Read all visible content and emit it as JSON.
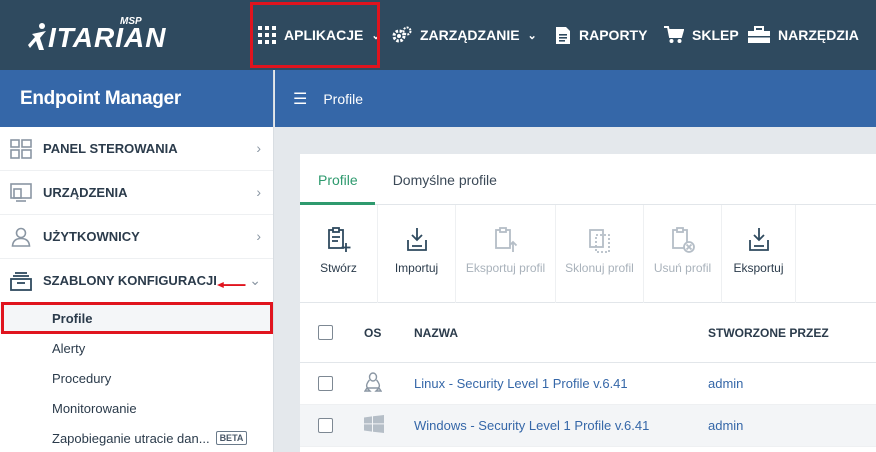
{
  "brand": {
    "name": "ITARIAN",
    "badge": "MSP"
  },
  "topnav": {
    "apps": "APLIKACJE",
    "management": "ZARZĄDZANIE",
    "reports": "RAPORTY",
    "shop": "SKLEP",
    "tools": "NARZĘDZIA"
  },
  "sidebar": {
    "title": "Endpoint Manager",
    "items": [
      {
        "label": "PANEL STEROWANIA",
        "icon": "dashboard-icon"
      },
      {
        "label": "URZĄDZENIA",
        "icon": "devices-icon"
      },
      {
        "label": "UŻYTKOWNICY",
        "icon": "user-icon"
      },
      {
        "label": "SZABLONY KONFIGURACJI",
        "icon": "templates-icon"
      }
    ],
    "subitems": [
      "Profile",
      "Alerty",
      "Procedury",
      "Monitorowanie",
      "Zapobieganie utracie dan..."
    ],
    "beta": "BETA"
  },
  "page": {
    "title": "Profile",
    "tabs": [
      "Profile",
      "Domyślne profile"
    ]
  },
  "toolbar": {
    "create": "Stwórz",
    "import": "Importuj",
    "export_profile": "Eksportuj profil",
    "clone_profile": "Sklonuj profil",
    "delete_profile": "Usuń profil",
    "export": "Eksportuj"
  },
  "table": {
    "headers": {
      "os": "OS",
      "name": "NAZWA",
      "created_by": "STWORZONE PRZEZ"
    },
    "rows": [
      {
        "os": "linux-icon",
        "name": "Linux - Security Level 1 Profile v.6.41",
        "created_by": "admin"
      },
      {
        "os": "windows-icon",
        "name": "Windows - Security Level 1 Profile v.6.41",
        "created_by": "admin"
      }
    ]
  },
  "colors": {
    "topbar": "#2f4a5f",
    "header_blue": "#3567a8",
    "accent_green": "#2e9a6e",
    "highlight_red": "#e0141e"
  }
}
